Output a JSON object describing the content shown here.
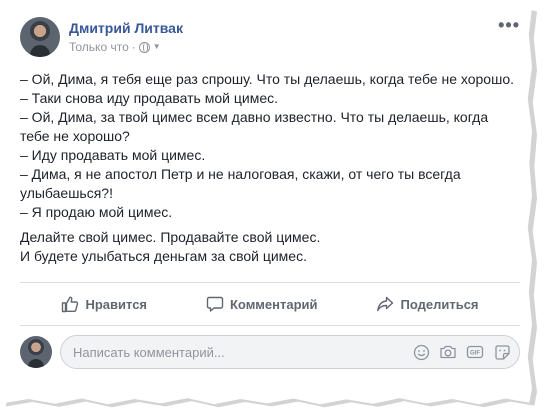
{
  "post": {
    "author": "Дмитрий Литвак",
    "time": "Только что",
    "separator": "·",
    "menu_glyph": "•••",
    "lines": [
      "– Ой, Дима, я тебя еще раз спрошу. Что ты делаешь, когда тебе не хорошо.",
      "– Таки снова иду продавать мой цимес.",
      "– Ой, Дима, за твой цимес всем давно известно. Что ты делаешь, когда тебе не хорошо?",
      "– Иду продавать мой цимес.",
      "– Дима, я не апостол Петр и не налоговая, скажи, от чего ты всегда улыбаешься?!",
      "– Я продаю мой цимес."
    ],
    "closing": [
      "Делайте свой цимес. Продавайте свой цимес.",
      "И будете улыбаться деньгам за свой цимес."
    ]
  },
  "actions": {
    "like": "Нравится",
    "comment": "Комментарий",
    "share": "Поделиться"
  },
  "comment": {
    "placeholder": "Написать комментарий...",
    "icons": [
      "emoji-icon",
      "camera-icon",
      "gif-icon",
      "sticker-icon"
    ]
  },
  "colors": {
    "author": "#385898",
    "muted": "#90949c",
    "text": "#1d2129",
    "action": "#606770"
  }
}
